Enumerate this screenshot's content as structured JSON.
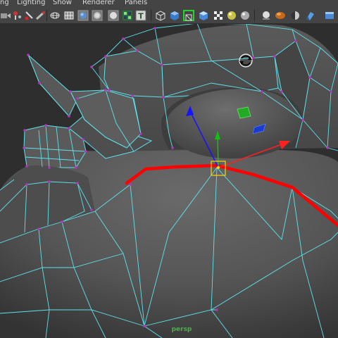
{
  "menu": {
    "items": [
      {
        "label": "ng"
      },
      {
        "label": "Lighting"
      },
      {
        "label": "Show"
      },
      {
        "label": "Renderer"
      },
      {
        "label": "Panels"
      }
    ]
  },
  "toolbar": {
    "icons": [
      "camera-select-icon",
      "camera-attributes-icon",
      "bookmark-icon",
      "image-plane-icon",
      "wireframe-icon",
      "grid-icon",
      "smooth-shade-icon",
      "flat-shade-icon",
      "textured-icon",
      "text-icon",
      "isolate-select-icon",
      "xray-active-icon",
      "backface-icon",
      "xray-icon",
      "default-material-icon",
      "use-lights-icon",
      "shadows-icon",
      "high-quality-icon",
      "ambient-occlusion-icon",
      "motion-blur-icon",
      "anti-alias-icon"
    ]
  },
  "viewport": {
    "camera_label": "persp",
    "colors": {
      "wire": "#5ee3ec",
      "vertex": "#b533c2",
      "selected_edge": "#ff0000",
      "axis_x": "#ff2020",
      "axis_y": "#10c010",
      "axis_z": "#1414ff",
      "manipulator_center": "#ffd400"
    }
  }
}
